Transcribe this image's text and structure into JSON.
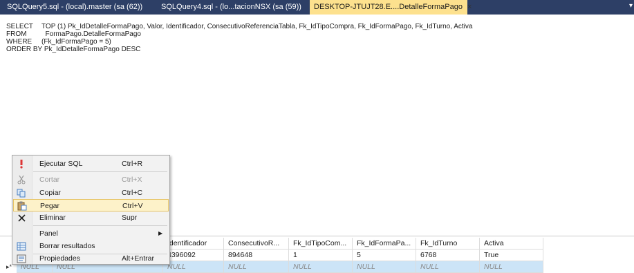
{
  "tabs": [
    {
      "label": "SQLQuery5.sql - (local).master (sa (62))"
    },
    {
      "label": "SQLQuery4.sql - (lo...tacionNSX (sa (59))"
    },
    {
      "label": "DESKTOP-JTUJT28.E....DetalleFormaPago",
      "close": "×"
    }
  ],
  "tab_overflow_icon": "▾",
  "editor": {
    "lines": [
      {
        "keyword": "SELECT",
        "text": "TOP (1) Pk_IdDetalleFormaPago, Valor, Identificador, ConsecutivoReferenciaTabla, Fk_IdTipoCompra, Fk_IdFormaPago, Fk_IdTurno, Activa"
      },
      {
        "keyword": "FROM",
        "text": "  FormaPago.DetalleFormaPago"
      },
      {
        "keyword": "WHERE",
        "text": "(Fk_IdFormaPago = 5)"
      },
      {
        "keyword": "ORDER BY",
        "text": "Pk_IdDetalleFormaPago DESC"
      }
    ]
  },
  "grid": {
    "columns": [
      "",
      "Identificador",
      "ConsecutivoR...",
      "Fk_IdTipoCom...",
      "Fk_IdFormaPa...",
      "Fk_IdTurno",
      "Activa"
    ],
    "rows": [
      [
        "",
        "4396092",
        "894648",
        "1",
        "5",
        "6768",
        "True"
      ],
      [
        "NULL",
        "NULL",
        "NULL",
        "NULL",
        "NULL",
        "NULL",
        "NULL"
      ]
    ],
    "hidden_row_first_cells": [
      "NULL",
      "NULL"
    ],
    "new_row_marker": "▸*"
  },
  "context_menu": {
    "items": [
      {
        "label": "Ejecutar SQL",
        "shortcut": "Ctrl+R",
        "icon": "execute-icon",
        "enabled": true
      },
      {
        "label": "Cortar",
        "shortcut": "Ctrl+X",
        "icon": "cut-icon",
        "enabled": false
      },
      {
        "label": "Copiar",
        "shortcut": "Ctrl+C",
        "icon": "copy-icon",
        "enabled": true
      },
      {
        "label": "Pegar",
        "shortcut": "Ctrl+V",
        "icon": "paste-icon",
        "enabled": true,
        "highlighted": true
      },
      {
        "label": "Eliminar",
        "shortcut": "Supr",
        "icon": "delete-icon",
        "enabled": true
      },
      {
        "label": "Panel",
        "shortcut": "",
        "icon": "",
        "enabled": true,
        "submenu": true
      },
      {
        "label": "Borrar resultados",
        "shortcut": "",
        "icon": "clear-results-icon",
        "enabled": true
      },
      {
        "label": "Propiedades",
        "shortcut": "Alt+Entrar",
        "icon": "properties-icon",
        "enabled": true
      }
    ]
  },
  "colors": {
    "tabbar": "#2d3f66",
    "active_tab": "#fde18e",
    "menu_highlight": "#fdf2c9",
    "selected_row": "#cce4f7"
  }
}
